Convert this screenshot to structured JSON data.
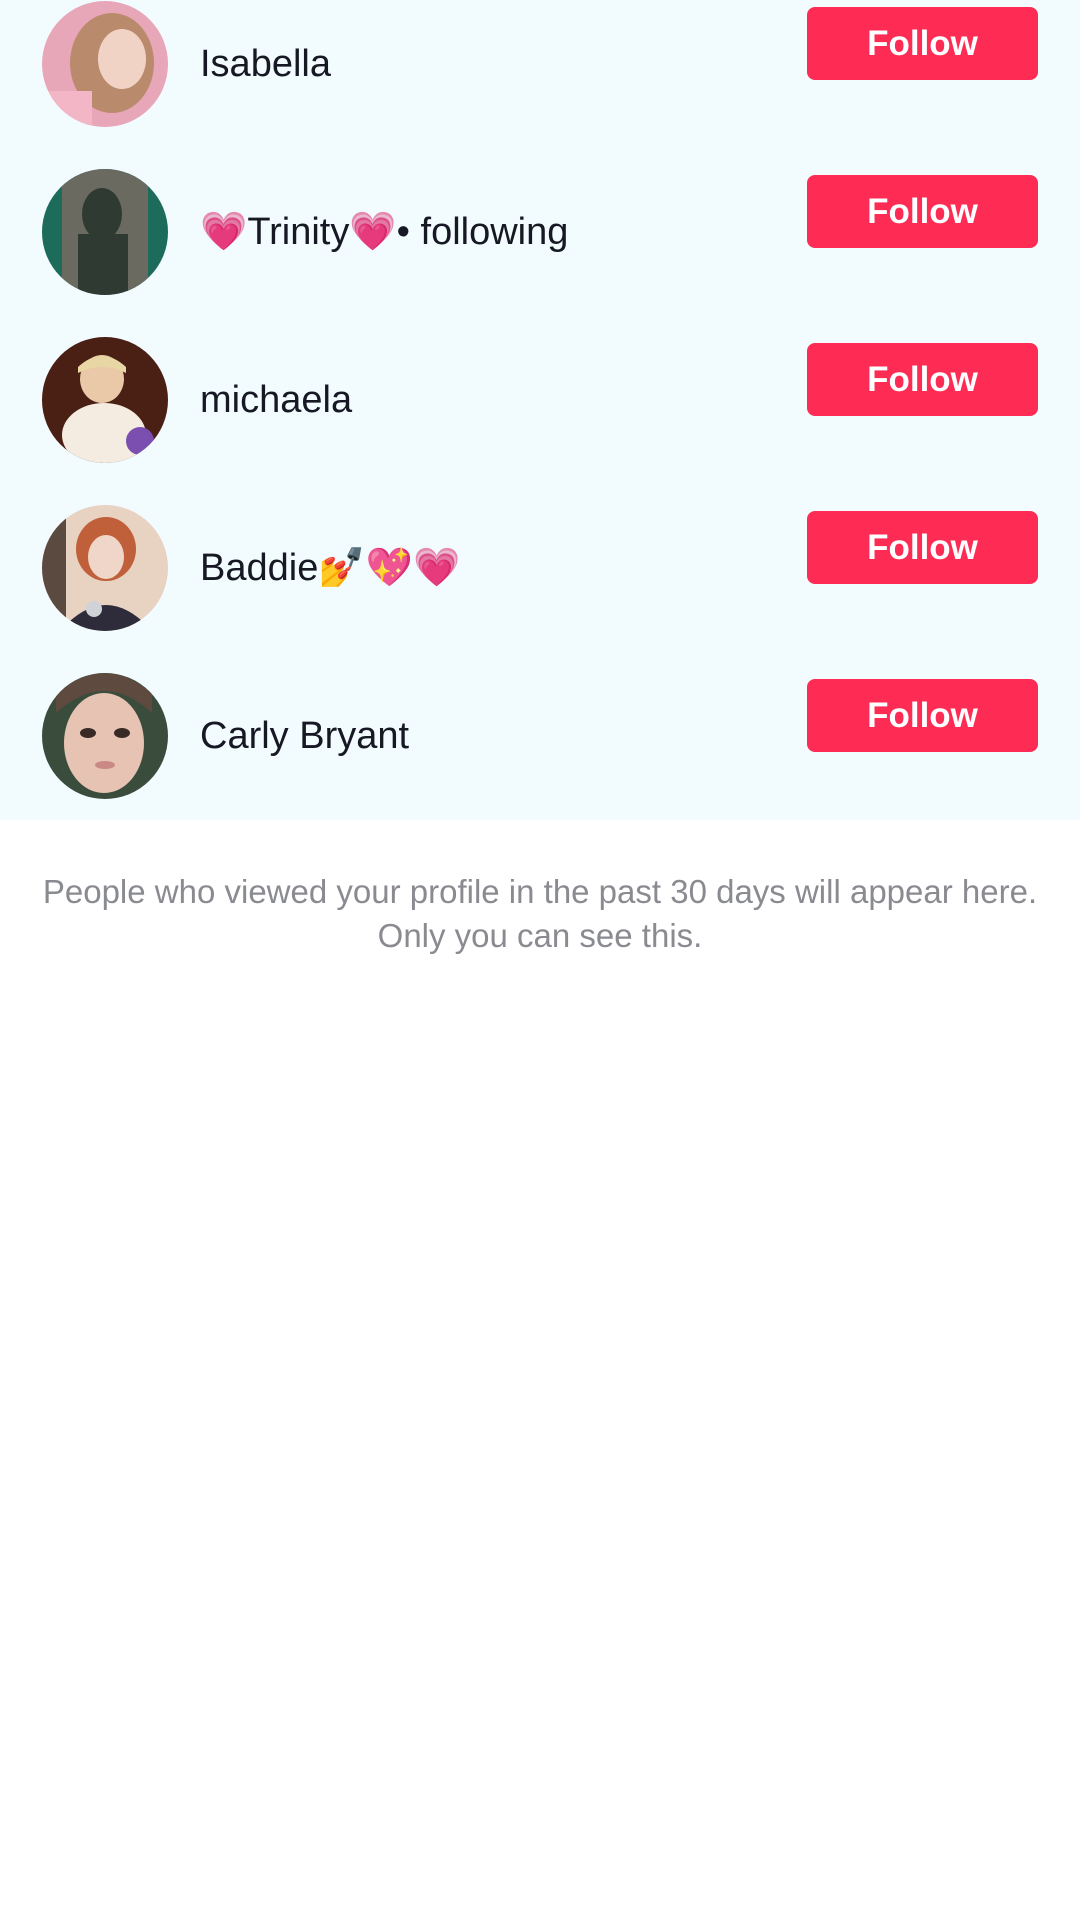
{
  "viewers": [
    {
      "username": "Isabella",
      "follow_label": "Follow",
      "avatar_colors": [
        "#e8a7b8",
        "#b98a6b",
        "#f1d3c6"
      ]
    },
    {
      "username": "💗Trinity💗• following",
      "follow_label": "Follow",
      "avatar_colors": [
        "#2f3a33",
        "#6b6a60",
        "#1d6b5a"
      ]
    },
    {
      "username": "michaela",
      "follow_label": "Follow",
      "avatar_colors": [
        "#4a1f14",
        "#f4ece0",
        "#7a4fb0"
      ]
    },
    {
      "username": "Baddie💅💖💗",
      "follow_label": "Follow",
      "avatar_colors": [
        "#2e2c3a",
        "#c0603a",
        "#e8d2c2"
      ]
    },
    {
      "username": "Carly Bryant",
      "follow_label": "Follow",
      "avatar_colors": [
        "#3a4d3c",
        "#e7c3b3",
        "#5f4a3f"
      ]
    }
  ],
  "footer": {
    "privacy_note": "People who viewed your profile in the past 30 days will appear here. Only you can see this."
  },
  "colors": {
    "accent": "#fe2c55",
    "list_background": "#f2fbfe",
    "text_primary": "#161823",
    "text_secondary": "#8a8b91"
  }
}
